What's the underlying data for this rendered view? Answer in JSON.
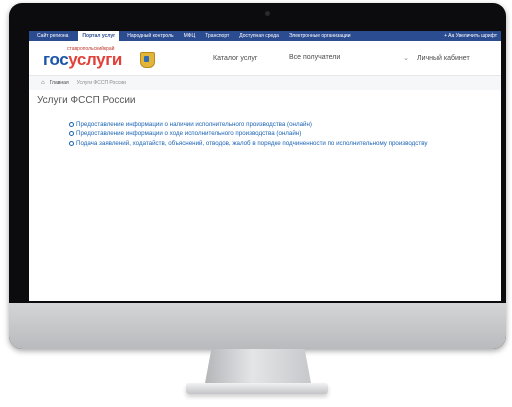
{
  "topnav": {
    "items": [
      {
        "label": "Сайт региона",
        "active": false
      },
      {
        "label": "Портал услуг",
        "active": true
      },
      {
        "label": "Народный контроль",
        "active": false
      },
      {
        "label": "МФЦ",
        "active": false
      },
      {
        "label": "Транспорт",
        "active": false
      },
      {
        "label": "Доступная среда",
        "active": false
      },
      {
        "label": "Электронные организации",
        "active": false
      }
    ],
    "accessibility_label": "+ Aa Увеличить шрифт"
  },
  "header": {
    "logo": {
      "region_text": "ставропольскийкрай",
      "brand_part1": "гос",
      "brand_part2": "услуги"
    },
    "catalog_label": "Каталог услуг",
    "recipients_label": "Все получатели",
    "recipients_chevron": "⌄",
    "cabinet_label": "Личный кабинет"
  },
  "breadcrumb": {
    "home_icon": "⌂",
    "home_label": "Главная",
    "current": "Услуги ФССП России"
  },
  "page_title": "Услуги ФССП России",
  "services": [
    "Предоставление информации о наличии исполнительного производства (онлайн)",
    "Предоставление информации о ходе исполнительного производства (онлайн)",
    "Подача заявлений, ходатайств, объяснений, отводов, жалоб в порядке подчиненности по исполнительному производству"
  ],
  "colors": {
    "topnav_bg": "#2c4c92",
    "link_blue": "#1a63b4",
    "brand_blue": "#1b55a8",
    "brand_red": "#e0413b"
  }
}
